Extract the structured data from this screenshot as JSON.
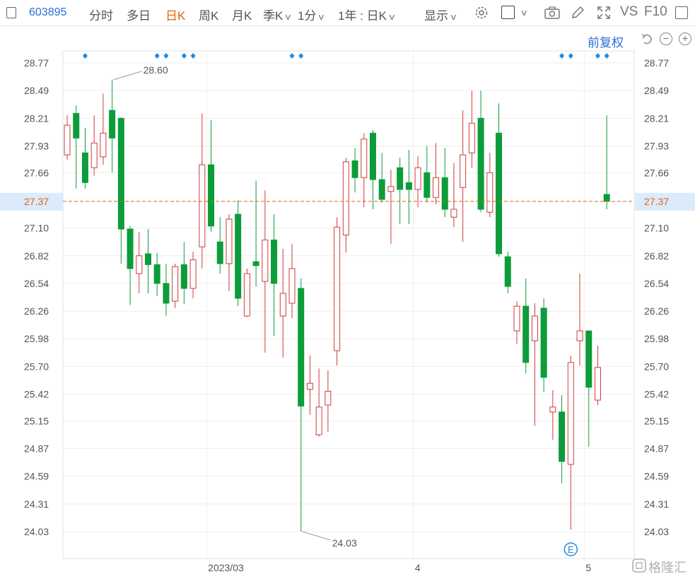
{
  "toolbar": {
    "code": "603895",
    "tabs": [
      "分时",
      "多日",
      "日K",
      "周K",
      "月K"
    ],
    "active_tab": "日K",
    "quarter_label": "季K",
    "minute_label": "1分",
    "range_label": "1年 : 日K",
    "display_label": "显示",
    "vs_label": "VS",
    "f10_label": "F10"
  },
  "adjust_label": "前复权",
  "watermark": "格隆汇",
  "colors": {
    "up": "#d23a3a",
    "down": "#0d9c3a",
    "accent": "#e8600c",
    "link": "#2a6fd6",
    "marker": "#1e88e5",
    "price_line": "#e8600c"
  },
  "chart_data": {
    "type": "candlestick",
    "y_ticks": [
      "28.77",
      "28.49",
      "28.21",
      "27.93",
      "27.66",
      "27.37",
      "27.10",
      "26.82",
      "26.54",
      "26.26",
      "25.98",
      "25.70",
      "25.42",
      "25.15",
      "24.87",
      "24.59",
      "24.31",
      "24.03"
    ],
    "ylim": [
      24.03,
      28.77
    ],
    "current_price": "27.37",
    "x_labels": [
      {
        "label": "2023/03",
        "index": 15.5
      },
      {
        "label": "4",
        "index": 38.5
      },
      {
        "label": "5",
        "index": 57.5
      }
    ],
    "max_label": "28.60",
    "max_index": 5,
    "min_label": "24.03",
    "min_index": 26,
    "event_label": "E",
    "event_index": 56,
    "marker_indices": [
      2,
      10,
      11,
      13,
      14,
      25,
      26,
      55,
      56,
      59,
      60
    ],
    "candles": [
      {
        "o": 27.84,
        "c": 28.14,
        "h": 28.24,
        "l": 27.79
      },
      {
        "o": 28.26,
        "c": 28.01,
        "h": 28.34,
        "l": 27.5
      },
      {
        "o": 27.86,
        "c": 27.56,
        "h": 28.11,
        "l": 27.5
      },
      {
        "o": 27.71,
        "c": 27.96,
        "h": 28.24,
        "l": 27.63
      },
      {
        "o": 27.82,
        "c": 28.06,
        "h": 28.46,
        "l": 27.74
      },
      {
        "o": 28.29,
        "c": 28.01,
        "h": 28.6,
        "l": 27.66
      },
      {
        "o": 28.21,
        "c": 27.09,
        "h": 28.22,
        "l": 26.74
      },
      {
        "o": 27.09,
        "c": 26.69,
        "h": 27.12,
        "l": 26.32
      },
      {
        "o": 26.64,
        "c": 26.82,
        "h": 27.06,
        "l": 26.44
      },
      {
        "o": 26.84,
        "c": 26.73,
        "h": 27.09,
        "l": 26.44
      },
      {
        "o": 26.73,
        "c": 26.54,
        "h": 26.85,
        "l": 26.41
      },
      {
        "o": 26.54,
        "c": 26.34,
        "h": 26.74,
        "l": 26.21
      },
      {
        "o": 26.36,
        "c": 26.71,
        "h": 26.74,
        "l": 26.29
      },
      {
        "o": 26.73,
        "c": 26.49,
        "h": 26.96,
        "l": 26.33
      },
      {
        "o": 26.49,
        "c": 26.78,
        "h": 26.86,
        "l": 26.39
      },
      {
        "o": 26.91,
        "c": 27.74,
        "h": 28.26,
        "l": 26.69
      },
      {
        "o": 27.74,
        "c": 27.12,
        "h": 28.19,
        "l": 27.06
      },
      {
        "o": 26.96,
        "c": 26.74,
        "h": 27.21,
        "l": 26.64
      },
      {
        "o": 26.74,
        "c": 27.19,
        "h": 27.24,
        "l": 26.46
      },
      {
        "o": 27.24,
        "c": 26.39,
        "h": 27.38,
        "l": 26.31
      },
      {
        "o": 26.21,
        "c": 26.64,
        "h": 26.69,
        "l": 26.2
      },
      {
        "o": 26.76,
        "c": 26.72,
        "h": 27.58,
        "l": 26.51
      },
      {
        "o": 26.56,
        "c": 26.98,
        "h": 27.48,
        "l": 25.84
      },
      {
        "o": 26.98,
        "c": 26.54,
        "h": 27.24,
        "l": 26.01
      },
      {
        "o": 26.21,
        "c": 26.44,
        "h": 26.89,
        "l": 25.79
      },
      {
        "o": 26.34,
        "c": 26.69,
        "h": 26.94,
        "l": 26.19
      },
      {
        "o": 26.49,
        "c": 25.3,
        "h": 26.59,
        "l": 24.03
      },
      {
        "o": 25.47,
        "c": 25.53,
        "h": 25.81,
        "l": 25.21
      },
      {
        "o": 25.01,
        "c": 25.29,
        "h": 25.68,
        "l": 24.99
      },
      {
        "o": 25.31,
        "c": 25.45,
        "h": 25.66,
        "l": 25.04
      },
      {
        "o": 25.86,
        "c": 27.11,
        "h": 27.21,
        "l": 25.71
      },
      {
        "o": 27.03,
        "c": 27.77,
        "h": 27.81,
        "l": 26.85
      },
      {
        "o": 27.78,
        "c": 27.61,
        "h": 27.91,
        "l": 27.46
      },
      {
        "o": 27.61,
        "c": 28.0,
        "h": 28.06,
        "l": 27.31
      },
      {
        "o": 28.06,
        "c": 27.59,
        "h": 28.09,
        "l": 27.29
      },
      {
        "o": 27.59,
        "c": 27.39,
        "h": 27.86,
        "l": 27.36
      },
      {
        "o": 27.47,
        "c": 27.52,
        "h": 27.69,
        "l": 26.94
      },
      {
        "o": 27.71,
        "c": 27.49,
        "h": 27.81,
        "l": 27.14
      },
      {
        "o": 27.56,
        "c": 27.49,
        "h": 27.89,
        "l": 27.14
      },
      {
        "o": 27.49,
        "c": 27.71,
        "h": 27.83,
        "l": 27.31
      },
      {
        "o": 27.66,
        "c": 27.41,
        "h": 27.93,
        "l": 27.36
      },
      {
        "o": 27.41,
        "c": 27.61,
        "h": 27.96,
        "l": 27.34
      },
      {
        "o": 27.61,
        "c": 27.29,
        "h": 27.91,
        "l": 27.21
      },
      {
        "o": 27.21,
        "c": 27.29,
        "h": 27.76,
        "l": 27.11
      },
      {
        "o": 27.51,
        "c": 27.84,
        "h": 28.29,
        "l": 26.96
      },
      {
        "o": 27.86,
        "c": 28.16,
        "h": 28.49,
        "l": 27.71
      },
      {
        "o": 28.21,
        "c": 27.29,
        "h": 28.49,
        "l": 27.26
      },
      {
        "o": 27.26,
        "c": 27.66,
        "h": 27.86,
        "l": 27.21
      },
      {
        "o": 28.06,
        "c": 26.84,
        "h": 28.36,
        "l": 26.81
      },
      {
        "o": 26.81,
        "c": 26.51,
        "h": 26.86,
        "l": 26.44
      },
      {
        "o": 26.06,
        "c": 26.31,
        "h": 26.36,
        "l": 25.93
      },
      {
        "o": 26.31,
        "c": 25.74,
        "h": 26.59,
        "l": 25.63
      },
      {
        "o": 25.96,
        "c": 26.21,
        "h": 26.34,
        "l": 25.1
      },
      {
        "o": 26.29,
        "c": 25.59,
        "h": 26.39,
        "l": 25.44
      },
      {
        "o": 25.24,
        "c": 25.29,
        "h": 25.46,
        "l": 24.96
      },
      {
        "o": 25.24,
        "c": 24.74,
        "h": 25.41,
        "l": 24.52
      },
      {
        "o": 24.71,
        "c": 25.74,
        "h": 25.81,
        "l": 24.05
      },
      {
        "o": 25.96,
        "c": 26.06,
        "h": 26.64,
        "l": 25.71
      },
      {
        "o": 26.06,
        "c": 25.49,
        "h": 26.06,
        "l": 24.89
      },
      {
        "o": 25.36,
        "c": 25.69,
        "h": 25.91,
        "l": 25.31
      },
      {
        "o": 27.44,
        "c": 27.37,
        "h": 28.24,
        "l": 27.29
      }
    ]
  }
}
